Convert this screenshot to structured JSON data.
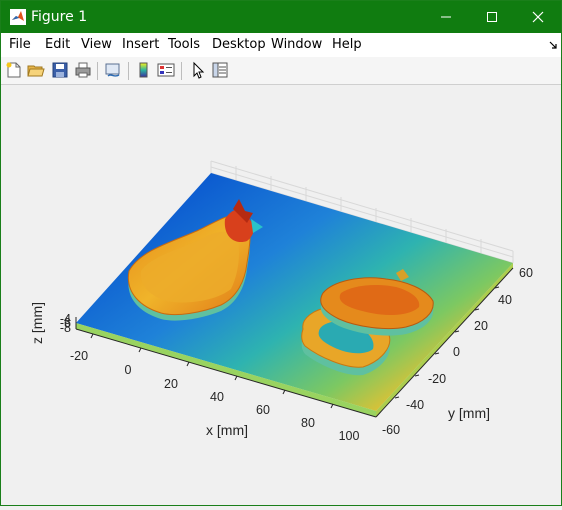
{
  "window": {
    "title": "Figure 1"
  },
  "menu": [
    "File",
    "Edit",
    "View",
    "Insert",
    "Tools",
    "Desktop",
    "Window",
    "Help"
  ],
  "toolbar": [
    "new-figure",
    "open-file",
    "save",
    "print",
    "link-plot",
    "insert-colorbar",
    "insert-legend",
    "edit-plot",
    "property-inspector"
  ],
  "colors": {
    "titlebar": "#107c10",
    "window_bg": "#f0f0f0"
  },
  "plot": {
    "type": "3d-surface",
    "x_label": "x [mm]",
    "y_label": "y [mm]",
    "z_label": "z [mm]",
    "x_ticks": [
      "-20",
      "0",
      "20",
      "40",
      "60",
      "80",
      "100"
    ],
    "y_ticks": [
      "60",
      "40",
      "20",
      "0",
      "-20",
      "-40",
      "-60"
    ],
    "z_ticks": [
      "-4",
      "-6",
      "-8"
    ]
  }
}
